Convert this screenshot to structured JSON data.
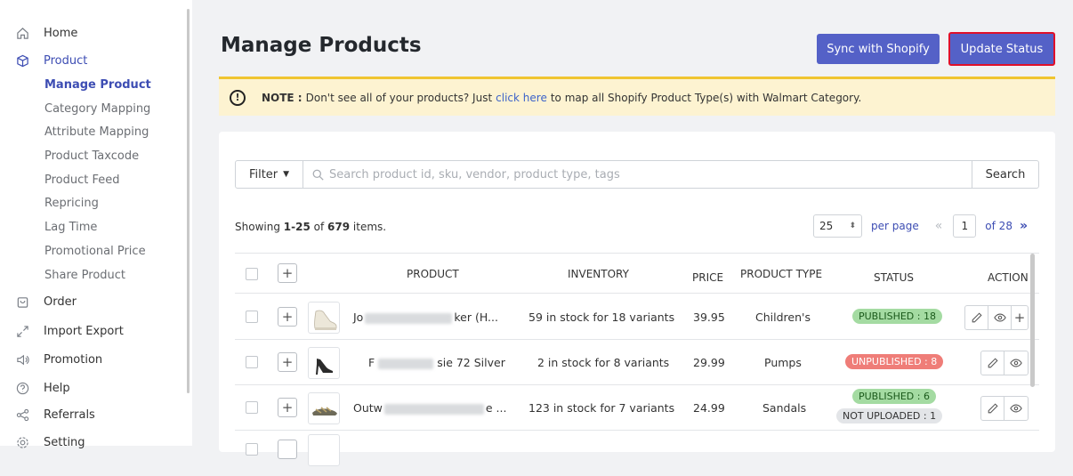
{
  "sidebar": {
    "items": [
      {
        "label": "Home",
        "icon": "home-icon"
      },
      {
        "label": "Product",
        "icon": "box-icon"
      },
      {
        "label": "Order",
        "icon": "bag-icon"
      },
      {
        "label": "Import Export",
        "icon": "expand-arrows-icon"
      },
      {
        "label": "Promotion",
        "icon": "megaphone-icon"
      },
      {
        "label": "Help",
        "icon": "help-icon"
      },
      {
        "label": "Referrals",
        "icon": "share-icon"
      },
      {
        "label": "Setting",
        "icon": "gear-icon"
      }
    ],
    "product_sub": [
      "Manage Product",
      "Category Mapping",
      "Attribute Mapping",
      "Product Taxcode",
      "Product Feed",
      "Repricing",
      "Lag Time",
      "Promotional Price",
      "Share Product"
    ]
  },
  "header": {
    "title": "Manage Products",
    "sync_label": "Sync with Shopify",
    "update_label": "Update Status"
  },
  "note": {
    "label": "NOTE :",
    "text_before": "Don't see all of your products? Just",
    "link": "click here",
    "text_after": "to map all Shopify Product Type(s) with Walmart Category."
  },
  "search": {
    "filter_label": "Filter",
    "placeholder": "Search product id, sku, vendor, product type, tags",
    "button": "Search"
  },
  "showing": {
    "prefix": "Showing",
    "range": "1-25",
    "of": "of",
    "total": "679",
    "suffix": "items."
  },
  "pager": {
    "per_page_value": "25",
    "per_page_label": "per page",
    "page": "1",
    "of_pages": "of 28"
  },
  "table": {
    "headers": {
      "product": "PRODUCT",
      "inventory": "INVENTORY",
      "price": "PRICE",
      "product_type": "PRODUCT TYPE",
      "status": "STATUS",
      "action": "ACTION"
    },
    "rows": [
      {
        "name_start": "Jo",
        "name_end": "ker (H...",
        "inventory": "59 in stock for 18 variants",
        "price": "39.95",
        "type": "Children's",
        "statuses": [
          "PUBLISHED : 18"
        ]
      },
      {
        "name_start": "F",
        "name_end": "sie 72 Silver",
        "inventory": "2 in stock for 8 variants",
        "price": "29.99",
        "type": "Pumps",
        "statuses": [
          "UNPUBLISHED : 8"
        ]
      },
      {
        "name_start": "Outw",
        "name_end": "e ...",
        "inventory": "123 in stock for 7 variants",
        "price": "24.99",
        "type": "Sandals",
        "statuses": [
          "PUBLISHED : 6",
          "NOT UPLOADED : 1"
        ]
      }
    ]
  },
  "colors": {
    "accent": "#5461c7",
    "active_nav": "#3d4db3",
    "published": "#a4dba2",
    "unpublished": "#ef7d78",
    "note_bg": "#fdf3d1",
    "highlight_border": "#e0102a"
  }
}
